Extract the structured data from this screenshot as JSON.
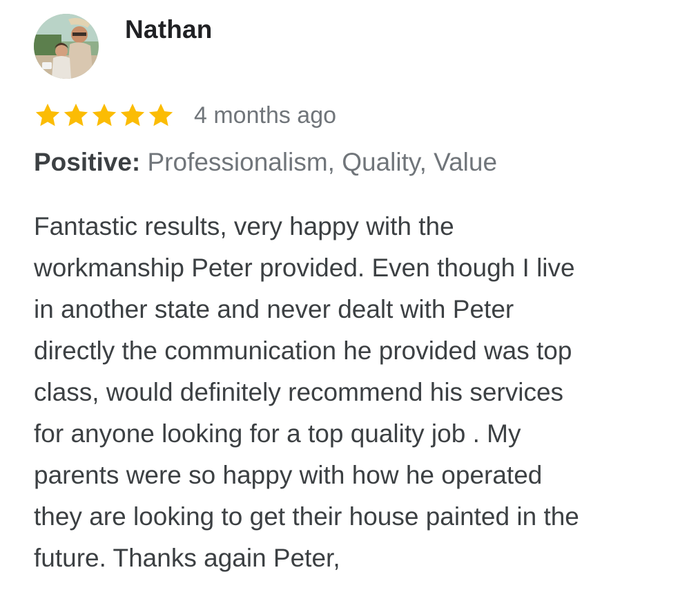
{
  "reviewer": {
    "name": "Nathan",
    "avatar_icon": "reviewer-photo"
  },
  "rating": {
    "stars": 5,
    "max": 5,
    "star_color": "#fbbc04"
  },
  "review": {
    "date": "4 months ago",
    "aspects_label": "Positive:",
    "aspects_values": " Professionalism, Quality, Value",
    "text": "Fantastic results, very happy with the\nworkmanship Peter provided. Even though I live\nin another state and never dealt with Peter\ndirectly the communication he provided was top\nclass, would definitely recommend his services\nfor anyone looking for a top quality job . My\nparents were so happy with how he operated\nthey are looking to get their house painted in the\nfuture. Thanks again Peter,"
  },
  "colors": {
    "text_primary": "#202124",
    "text_body": "#3c4043",
    "text_secondary": "#70757a"
  }
}
